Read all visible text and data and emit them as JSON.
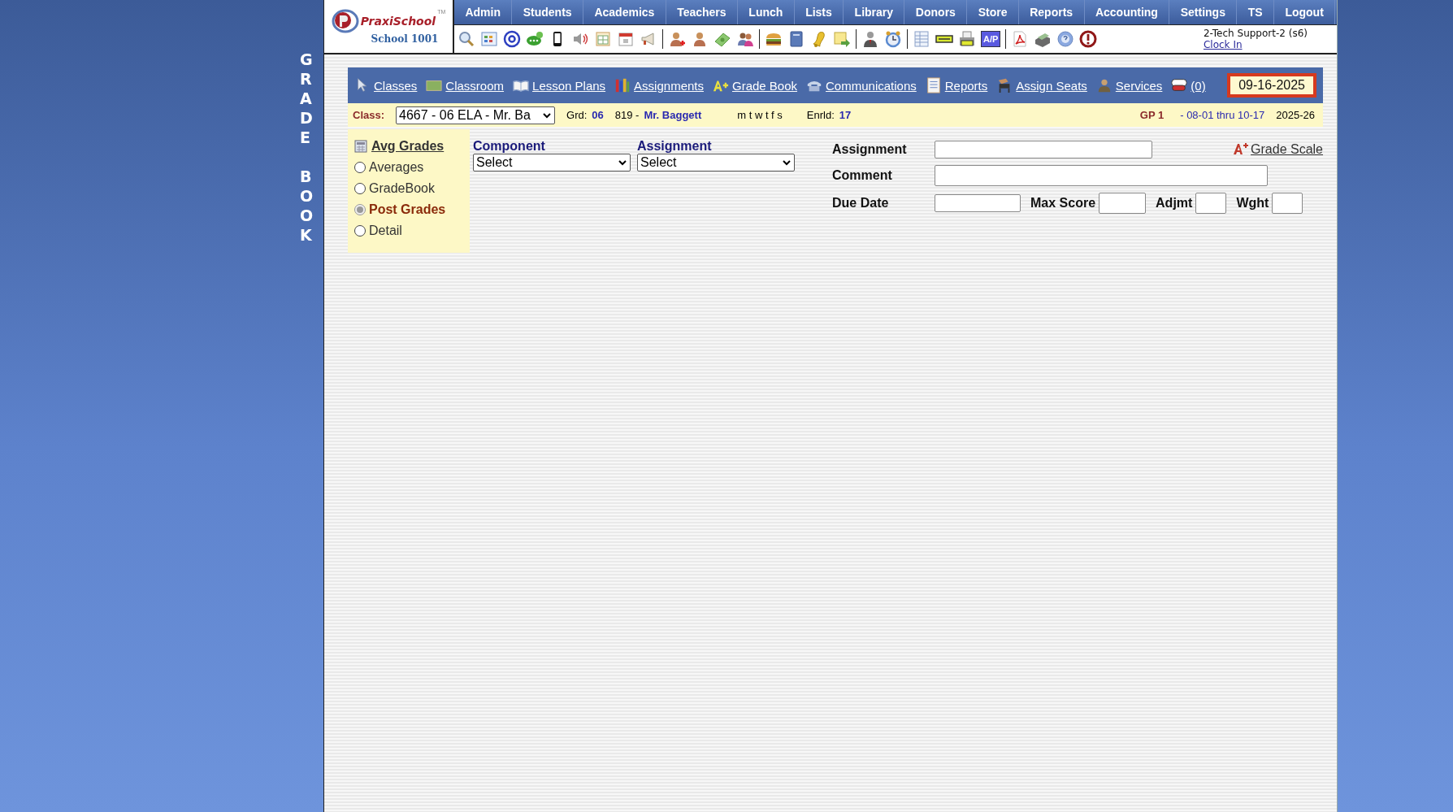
{
  "logo": {
    "brand": "PraxiSchool",
    "tm": "TM",
    "school": "School 1001"
  },
  "menu": [
    {
      "label": "Admin"
    },
    {
      "label": "Students"
    },
    {
      "label": "Academics"
    },
    {
      "label": "Teachers"
    },
    {
      "label": "Lunch"
    },
    {
      "label": "Lists"
    },
    {
      "label": "Library"
    },
    {
      "label": "Donors"
    },
    {
      "label": "Store"
    },
    {
      "label": "Reports"
    },
    {
      "label": "Accounting"
    },
    {
      "label": "Settings"
    },
    {
      "label": "TS"
    },
    {
      "label": "Logout"
    }
  ],
  "toolbar": {
    "ap_badge": "A/P"
  },
  "user": {
    "name": "2-Tech Support-2 (s6)",
    "clock_link": "Clock In"
  },
  "side_title": "GRADE BOOK",
  "nav": {
    "items": [
      {
        "label": "Classes"
      },
      {
        "label": "Classroom"
      },
      {
        "label": "Lesson Plans"
      },
      {
        "label": "Assignments"
      },
      {
        "label": "Grade Book"
      },
      {
        "label": "Communications"
      },
      {
        "label": "Reports"
      },
      {
        "label": "Assign Seats"
      },
      {
        "label": "Services"
      },
      {
        "label": "(0)"
      }
    ],
    "date": "09-16-2025"
  },
  "class_bar": {
    "class_label": "Class:",
    "class_value": "4667 - 06 ELA - Mr. Ba",
    "grade_label": "Grd:",
    "grade": "06",
    "teacher_no": "819 -",
    "teacher": "Mr. Baggett",
    "days": "m t w t f s",
    "enrolled_label": "Enrld:",
    "enrolled": "17",
    "period": "GP 1",
    "period_dates": "- 08-01 thru 10-17",
    "school_year": "2025-26"
  },
  "views": {
    "title": "Avg Grades",
    "options": [
      {
        "label": "Averages",
        "selected": false
      },
      {
        "label": "GradeBook",
        "selected": false
      },
      {
        "label": "Post Grades",
        "selected": true
      },
      {
        "label": "Detail",
        "selected": false
      }
    ]
  },
  "filters": [
    {
      "label": "Component",
      "value": "Select"
    },
    {
      "label": "Assignment",
      "value": "Select"
    }
  ],
  "form": {
    "assignment_label": "Assignment",
    "grade_scale": "Grade Scale",
    "comment_label": "Comment",
    "due_date_label": "Due Date",
    "max_score_label": "Max Score",
    "adjmt_label": "Adjmt",
    "wght_label": "Wght"
  }
}
